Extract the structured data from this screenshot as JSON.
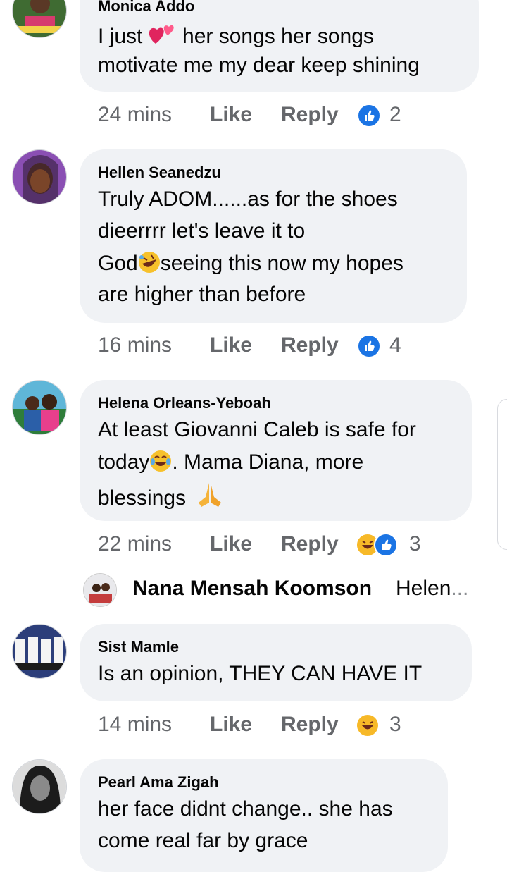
{
  "comments": [
    {
      "author": "Monica Addo",
      "lines": [
        "I just",
        "her songs  her songs",
        "motivate me my dear keep shining"
      ],
      "time": "24 mins",
      "like": "Like",
      "reply": "Reply",
      "reaction_count": "2"
    },
    {
      "author": "Hellen Seanedzu",
      "lines": [
        "Truly ADOM......as for the shoes",
        "dieerrrr let's leave it to",
        "God",
        "seeing this now my hopes",
        "are higher than before"
      ],
      "time": "16 mins",
      "like": "Like",
      "reply": "Reply",
      "reaction_count": "4"
    },
    {
      "author": "Helena Orleans-Yeboah",
      "lines": [
        "At least Giovanni Caleb is safe for",
        "today",
        ". Mama Diana, more",
        "blessings"
      ],
      "time": "22 mins",
      "like": "Like",
      "reply": "Reply",
      "reaction_count": "3"
    },
    {
      "author": "Sist Mamle",
      "lines": [
        "Is an opinion, THEY CAN HAVE IT"
      ],
      "time": "14 mins",
      "like": "Like",
      "reply": "Reply",
      "reaction_count": "3"
    },
    {
      "author": "Pearl Ama Zigah",
      "lines": [
        "her face didnt change.. she has",
        "come real far by grace"
      ]
    }
  ],
  "reply_preview": {
    "name": "Nana Mensah Koomson",
    "text": "Helen",
    "ellipsis": "..."
  },
  "colors": {
    "bubble": "#f0f2f5",
    "meta_text": "#65676b",
    "like_blue": "#1b74e4",
    "haha_yellow": "#f7b928"
  }
}
